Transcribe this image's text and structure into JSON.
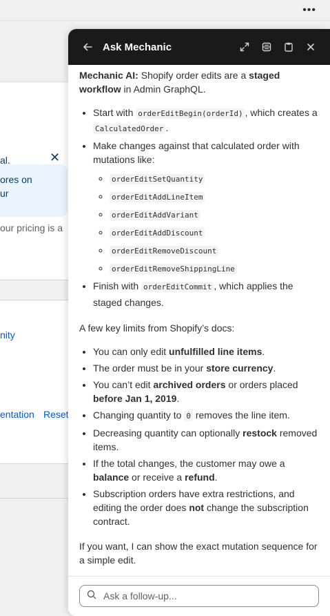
{
  "background": {
    "banner_lines": [
      "al.",
      "ores on",
      "ur"
    ],
    "pricing_text": "our pricing is a",
    "community_link": "nity",
    "documentation_link": "entation",
    "reset_link": "Reset"
  },
  "panel": {
    "title": "Ask Mechanic",
    "intro": {
      "label": "Mechanic AI:",
      "text_1": " Shopify order edits are a ",
      "bold_1": "staged workflow",
      "text_2": " in Admin GraphQL."
    },
    "steps": {
      "start_prefix": "Start with ",
      "start_code": "orderEditBegin(orderId)",
      "start_middle": ", which creates a ",
      "start_code_2": "CalculatedOrder",
      "start_suffix": ".",
      "make_text": "Make changes against that calculated order with mutations like:",
      "mutations": [
        "orderEditSetQuantity",
        "orderEditAddLineItem",
        "orderEditAddVariant",
        "orderEditAddDiscount",
        "orderEditRemoveDiscount",
        "orderEditRemoveShippingLine"
      ],
      "finish_prefix": "Finish with ",
      "finish_code": "orderEditCommit",
      "finish_suffix": ", which applies the staged changes."
    },
    "limits_heading": "A few key limits from Shopify’s docs:",
    "limits": {
      "l1_a": "You can only edit ",
      "l1_b": "unfulfilled line items",
      "l1_c": ".",
      "l2_a": "The order must be in your ",
      "l2_b": "store currency",
      "l2_c": ".",
      "l3_a": "You can’t edit ",
      "l3_b": "archived orders",
      "l3_c": " or orders placed ",
      "l3_d": "before Jan 1, 2019",
      "l3_e": ".",
      "l4_a": "Changing quantity to ",
      "l4_code": "0",
      "l4_c": " removes the line item.",
      "l5_a": "Decreasing quantity can optionally ",
      "l5_b": "restock",
      "l5_c": " removed items.",
      "l6_a": "If the total changes, the customer may owe a ",
      "l6_b": "balance",
      "l6_c": " or receive a ",
      "l6_d": "refund",
      "l6_e": ".",
      "l7_a": "Subscription orders have extra restrictions, and editing the order does ",
      "l7_b": "not",
      "l7_c": " change the subscription contract."
    },
    "closing": "If you want, I can show the exact mutation sequence for a simple edit.",
    "input_placeholder": "Ask a follow-up..."
  },
  "icons": [
    "more-horizontal-icon",
    "back-arrow-icon",
    "expand-icon",
    "layout-icon",
    "clipboard-icon",
    "close-icon",
    "search-icon"
  ]
}
